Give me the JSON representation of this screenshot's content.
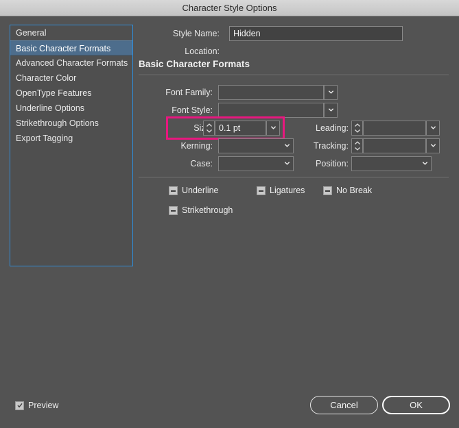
{
  "window": {
    "title": "Character Style Options"
  },
  "sidebar": {
    "items": [
      {
        "label": "General",
        "selected": false
      },
      {
        "label": "Basic Character Formats",
        "selected": true
      },
      {
        "label": "Advanced Character Formats",
        "selected": false
      },
      {
        "label": "Character Color",
        "selected": false
      },
      {
        "label": "OpenType Features",
        "selected": false
      },
      {
        "label": "Underline Options",
        "selected": false
      },
      {
        "label": "Strikethrough Options",
        "selected": false
      },
      {
        "label": "Export Tagging",
        "selected": false
      }
    ]
  },
  "header": {
    "style_name_label": "Style Name:",
    "style_name_value": "Hidden",
    "location_label": "Location:",
    "location_value": ""
  },
  "section": {
    "heading": "Basic Character Formats"
  },
  "fields": {
    "font_family": {
      "label": "Font Family:",
      "value": ""
    },
    "font_style": {
      "label": "Font Style:",
      "value": ""
    },
    "size": {
      "label": "Size:",
      "value": "0.1 pt"
    },
    "leading": {
      "label": "Leading:",
      "value": ""
    },
    "kerning": {
      "label": "Kerning:",
      "value": ""
    },
    "tracking": {
      "label": "Tracking:",
      "value": ""
    },
    "case": {
      "label": "Case:",
      "value": ""
    },
    "position": {
      "label": "Position:",
      "value": ""
    }
  },
  "checkboxes": [
    {
      "label": "Underline",
      "state": "indeterminate"
    },
    {
      "label": "Ligatures",
      "state": "indeterminate"
    },
    {
      "label": "No Break",
      "state": "indeterminate"
    },
    {
      "label": "Strikethrough",
      "state": "indeterminate"
    }
  ],
  "footer": {
    "preview_label": "Preview",
    "preview_checked": true,
    "cancel_label": "Cancel",
    "ok_label": "OK"
  },
  "highlight": {
    "target": "size-field",
    "color": "#e8177f"
  },
  "colors": {
    "dialog_background": "#535353",
    "titlebar_top": "#d8d8d8",
    "sidebar_background": "#4f4f4f",
    "sidebar_focus_border": "#2f8fdd",
    "selection_blue": "#4d6d8c",
    "field_background": "#4a4a4a",
    "field_border": "#828282",
    "text": "#e9e9e9",
    "highlight_magenta": "#e8177f"
  }
}
